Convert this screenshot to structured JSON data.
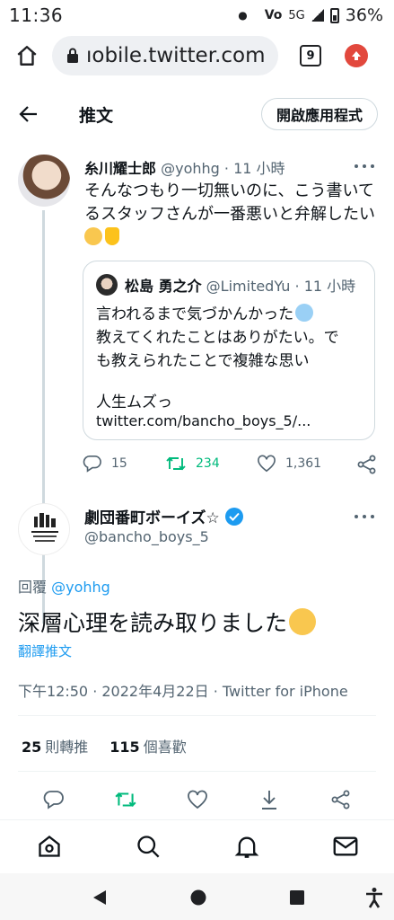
{
  "status_bar": {
    "time": "11:36",
    "network": "5G",
    "battery": "36%"
  },
  "browser": {
    "url": "ıobile.twitter.com",
    "tab_count": "9"
  },
  "header": {
    "title": "推文",
    "open_app_label": "開啟應用程式"
  },
  "parent_tweet": {
    "name": "糸川耀士郎",
    "handle": "@yohhg",
    "separator": "·",
    "time": "11 小時",
    "text_line1": "そんなつもり一切無いのに、こう書いて",
    "text_line2": "るスタッフさんが一番悪いと弁解したい",
    "emojis": [
      "pensive-face",
      "thumbs-up"
    ],
    "quote": {
      "name": "松島 勇之介",
      "handle": "@LimitedYu",
      "separator": "·",
      "time": "11 小時",
      "line1": "言われるまで気づかんかった",
      "line2": "教えてくれたことはありがたい。で",
      "line3": "も教えられたことで複雑な思い",
      "line4": "人生ムズっ",
      "link": "twitter.com/bancho_boys_5/..."
    },
    "replies": "15",
    "retweets": "234",
    "likes": "1,361"
  },
  "main_tweet": {
    "name": "劇団番町ボーイズ☆",
    "handle": "@bancho_boys_5",
    "reply_prefix": "回覆",
    "reply_to": "@yohhg",
    "text": "深層心理を読み取りました",
    "emoji": "kissing-face",
    "translate": "翻譯推文",
    "timestamp": "下午12:50 · 2022年4月22日 · Twitter for iPhone",
    "retweet_count": "25",
    "retweet_label": "則轉推",
    "like_count": "115",
    "like_label": "個喜歡"
  },
  "colors": {
    "accent": "#1d9bf0",
    "retweet": "#00ba7c",
    "secondary_text": "#536471",
    "browser_menu": "#e2483d"
  }
}
